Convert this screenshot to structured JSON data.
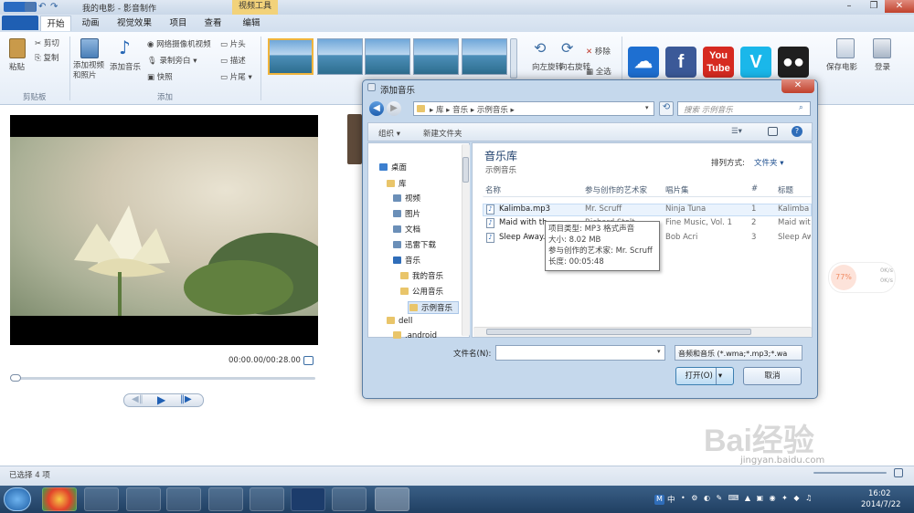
{
  "window": {
    "app_title": "我的电影 - 影音制作",
    "context_tab": "视频工具"
  },
  "tabs": [
    "开始",
    "动画",
    "视觉效果",
    "项目",
    "查看",
    "编辑"
  ],
  "ribbon": {
    "clipboard": {
      "paste": "粘贴",
      "cut": "剪切",
      "copy": "复制",
      "group": "剪贴板"
    },
    "add": {
      "add_video": "添加视频和照片",
      "add_music": "添加音乐",
      "webcam": "网络摄像机视频",
      "record_narration": "录制旁白",
      "snapshot": "快照",
      "title": "片头",
      "caption": "描述",
      "credits": "片尾",
      "group": "添加"
    },
    "editing": {
      "rotate_left": "向左旋转",
      "rotate_right": "向右旋转",
      "remove": "移除",
      "select_all": "全选"
    },
    "share": {
      "save_movie": "保存电影",
      "signin": "登录"
    }
  },
  "player": {
    "time": "00:00.00/00:28.00",
    "progress": 0
  },
  "status_left": "已选择 4 项",
  "dialog": {
    "title": "添加音乐",
    "breadcrumb": [
      "库",
      "音乐",
      "示例音乐"
    ],
    "search_placeholder": "搜索 示例音乐",
    "toolbar": {
      "organize": "组织 ▾",
      "new_folder": "新建文件夹"
    },
    "library_title": "音乐库",
    "library_sub": "示例音乐",
    "arrange_label": "排列方式:",
    "arrange_value": "文件夹 ▾",
    "nav": [
      {
        "label": "桌面",
        "icon": "desktop-icon"
      },
      {
        "label": "库",
        "icon": "library-icon"
      },
      {
        "label": "视频",
        "icon": "video-library-icon"
      },
      {
        "label": "图片",
        "icon": "picture-library-icon"
      },
      {
        "label": "文档",
        "icon": "document-library-icon"
      },
      {
        "label": "迅雷下载",
        "icon": "download-library-icon"
      },
      {
        "label": "音乐",
        "icon": "music-library-icon"
      },
      {
        "label": "我的音乐",
        "icon": "folder-icon"
      },
      {
        "label": "公用音乐",
        "icon": "folder-icon"
      },
      {
        "label": "示例音乐",
        "icon": "folder-icon"
      },
      {
        "label": "dell",
        "icon": "folder-icon"
      },
      {
        "label": ".android",
        "icon": "folder-icon"
      }
    ],
    "columns": [
      "名称",
      "参与创作的艺术家",
      "唱片集",
      "#",
      "标题"
    ],
    "rows": [
      {
        "name": "Kalimba.mp3",
        "artist": "Mr. Scruff",
        "album": "Ninja Tuna",
        "num": "1",
        "title": "Kalimba"
      },
      {
        "name": "Maid with th",
        "artist": "Richard Stolt",
        "album": "Fine Music, Vol. 1",
        "num": "2",
        "title": "Maid with"
      },
      {
        "name": "Sleep Away.",
        "artist": "",
        "album": "Bob Acri",
        "num": "3",
        "title": "Sleep Aw"
      }
    ],
    "tooltip": [
      "项目类型: MP3 格式声音",
      "大小: 8.02 MB",
      "参与创作的艺术家: Mr. Scruff",
      "长度: 00:05:48"
    ],
    "filename_label": "文件名(N):",
    "filename_value": "",
    "filetype": "音频和音乐 (*.wma;*.mp3;*.wa",
    "open": "打开(O)",
    "cancel": "取消"
  },
  "taskbar": {
    "clock_time": "16:02",
    "clock_date": "2014/7/22",
    "ime": "中"
  },
  "social_tiles": [
    {
      "name": "onedrive-icon",
      "color": "#1e6fd1",
      "glyph": "☁"
    },
    {
      "name": "facebook-icon",
      "color": "#3b5998",
      "glyph": "f"
    },
    {
      "name": "youtube-icon",
      "color": "#d62a21",
      "glyph": "You Tube"
    },
    {
      "name": "vimeo-icon",
      "color": "#1ab7ea",
      "glyph": "V"
    },
    {
      "name": "flickr-icon",
      "color": "#1f1f1f",
      "glyph": "●●"
    }
  ],
  "overlay": {
    "speed_up": "0K/s",
    "speed_down": "0K/s",
    "pct": "77%",
    "watermark": "Bai经验",
    "watermark_url": "jingyan.baidu.com"
  }
}
